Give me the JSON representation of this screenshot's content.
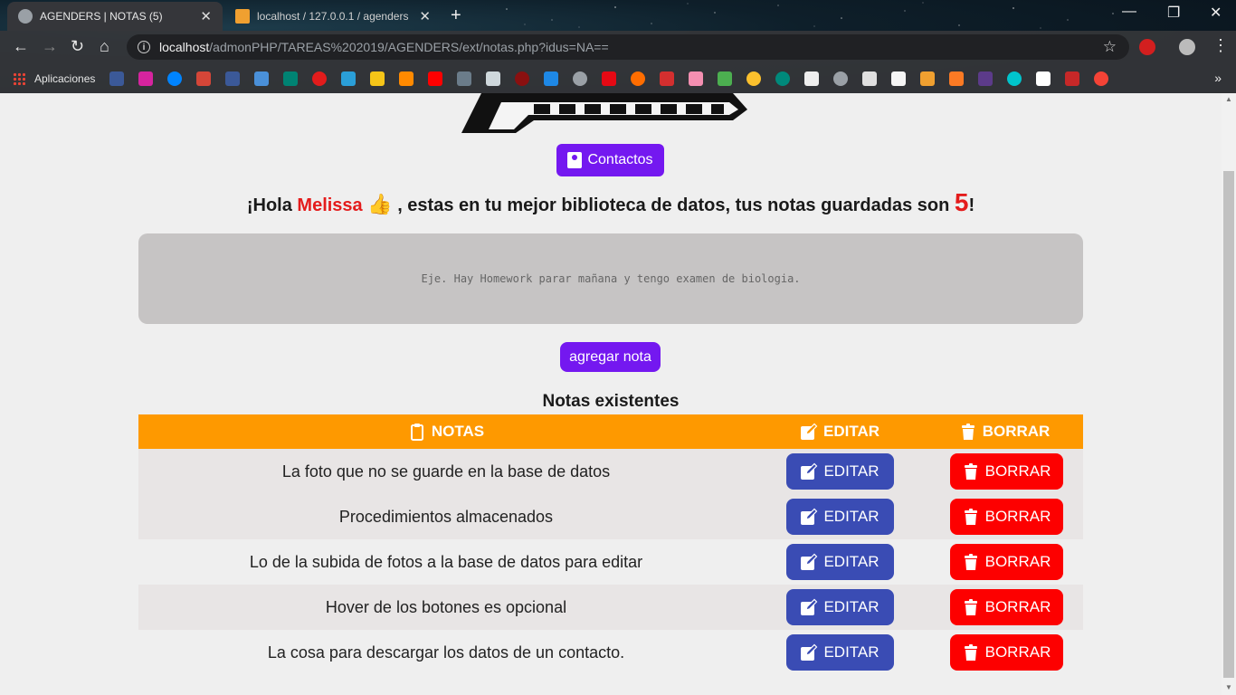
{
  "browser": {
    "tabs": [
      {
        "title": "AGENDERS | NOTAS (5)",
        "active": true
      },
      {
        "title": "localhost / 127.0.0.1 / agenders",
        "active": false
      }
    ],
    "url_host": "localhost",
    "url_path": "/admonPHP/TAREAS%202019/AGENDERS/ext/notas.php?idus=NA==",
    "bookmarks_apps_label": "Aplicaciones"
  },
  "page": {
    "contactos_label": "Contactos",
    "greeting": {
      "prefix": "¡Hola ",
      "name": "Melissa",
      "middle": " , estas en tu mejor biblioteca de datos, tus notas guardadas son ",
      "count": "5",
      "suffix": "!"
    },
    "note_placeholder": "Eje. Hay Homework parar mañana y tengo examen de biologia.",
    "agregar_label": "agregar nota",
    "table_title": "Notas existentes",
    "table_headers": {
      "notas": "NOTAS",
      "editar": "EDITAR",
      "borrar": "BORRAR"
    },
    "notes": [
      {
        "text": "La foto que no se guarde en la base de datos",
        "edit": "EDITAR",
        "delete": "BORRAR"
      },
      {
        "text": "Procedimientos almacenados",
        "edit": "EDITAR",
        "delete": "BORRAR"
      },
      {
        "text": "Lo de la subida de fotos a la base de datos para editar",
        "edit": "EDITAR",
        "delete": "BORRAR"
      },
      {
        "text": "Hover de los botones es opcional",
        "edit": "EDITAR",
        "delete": "BORRAR"
      },
      {
        "text": "La cosa para descargar los datos de un contacto.",
        "edit": "EDITAR",
        "delete": "BORRAR"
      }
    ]
  },
  "colors": {
    "primary_purple": "#7418f0",
    "header_orange": "#fe9900",
    "edit_blue": "#3a4cb4",
    "delete_red": "#fd0000",
    "highlight_red": "#e41c1c"
  }
}
